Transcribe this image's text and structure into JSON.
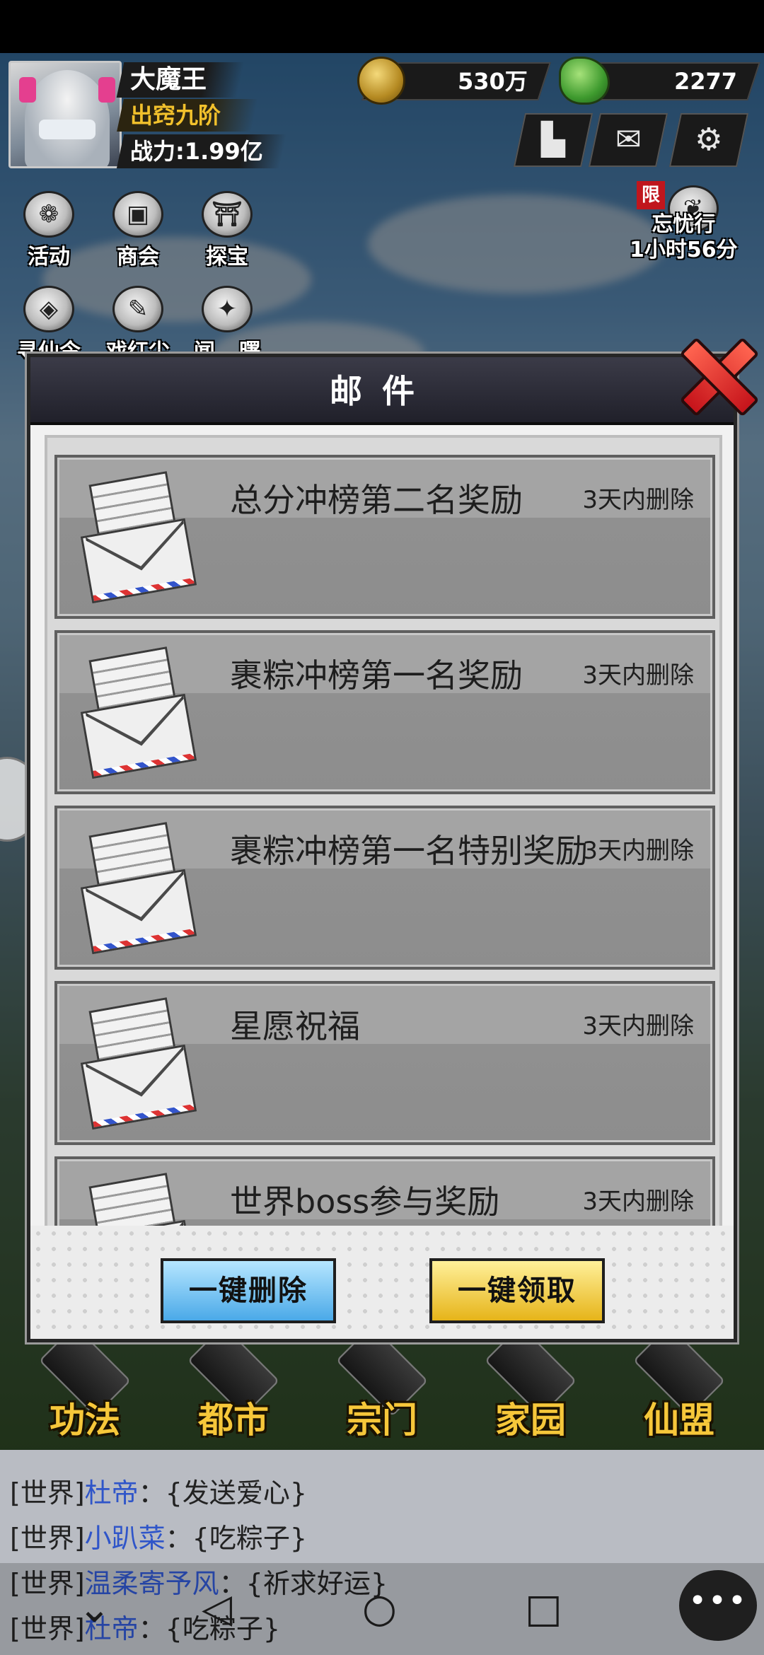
{
  "hud": {
    "player_name": "大魔王",
    "rank": "出窍九阶",
    "power": "战力:1.99亿",
    "coins": "530万",
    "jade": "2277"
  },
  "side_icons": [
    {
      "label": "活动",
      "icon": "balloon-icon"
    },
    {
      "label": "商会",
      "icon": "shop-icon"
    },
    {
      "label": "探宝",
      "icon": "gate-icon"
    },
    {
      "label": "寻仙令",
      "icon": "token-icon"
    },
    {
      "label": "戏红尘",
      "icon": "brush-icon"
    },
    {
      "label": "闻...曙",
      "icon": "scroll-icon"
    }
  ],
  "event": {
    "limit_tag": "限",
    "name": "忘忧行",
    "timer": "1小时56分"
  },
  "modal": {
    "title": "邮件",
    "mails": [
      {
        "title": "总分冲榜第二名奖励",
        "expire": "3天内删除"
      },
      {
        "title": "裹粽冲榜第一名奖励",
        "expire": "3天内删除"
      },
      {
        "title": "裹粽冲榜第一名特别奖励",
        "expire": "3天内删除"
      },
      {
        "title": "星愿祝福",
        "expire": "3天内删除"
      },
      {
        "title": "世界boss参与奖励",
        "expire": "3天内删除"
      }
    ],
    "delete_all": "一键删除",
    "claim_all": "一键领取"
  },
  "bottom_nav": [
    "功法",
    "都市",
    "宗门",
    "家园",
    "仙盟"
  ],
  "chat": [
    {
      "channel": "[世界]",
      "nick": "杜帝",
      "msg": "：{发送爱心}"
    },
    {
      "channel": "[世界]",
      "nick": "小趴菜",
      "msg": "：{吃粽子}"
    },
    {
      "channel": "[世界]",
      "nick": "温柔寄予风",
      "msg": "：{祈求好运}"
    },
    {
      "channel": "[世界]",
      "nick": "杜帝",
      "msg": "：{吃粽子}"
    }
  ],
  "colors": {
    "modal_header": "#2a2a36",
    "delete_button": "#4aa9e8",
    "claim_button": "#e6b419",
    "chat_nick": "#2f55c9",
    "close_button": "#d8252a"
  }
}
